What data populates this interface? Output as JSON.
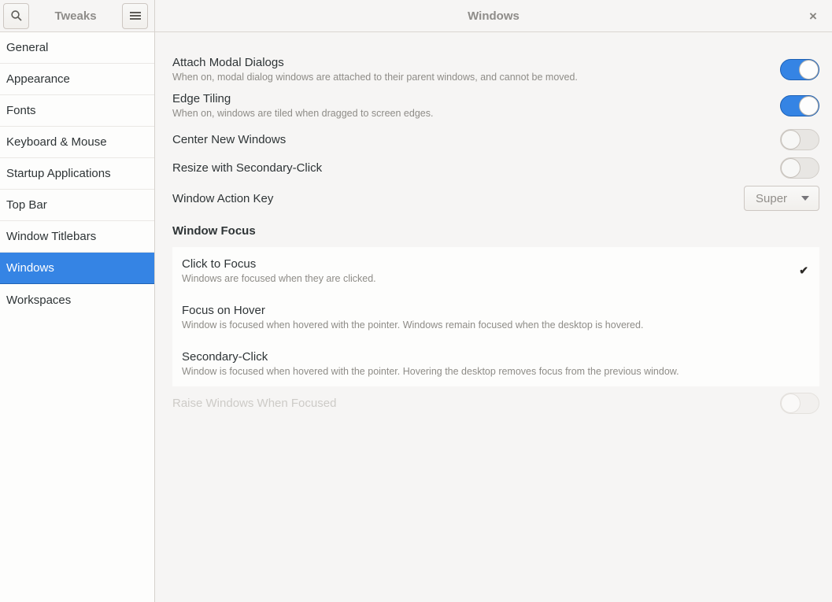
{
  "header": {
    "sidebar_title": "Tweaks",
    "main_title": "Windows"
  },
  "icons": {
    "close": "×",
    "check": "✔"
  },
  "sidebar": {
    "items": [
      {
        "label": "General",
        "selected": false
      },
      {
        "label": "Appearance",
        "selected": false
      },
      {
        "label": "Fonts",
        "selected": false
      },
      {
        "label": "Keyboard & Mouse",
        "selected": false
      },
      {
        "label": "Startup Applications",
        "selected": false
      },
      {
        "label": "Top Bar",
        "selected": false
      },
      {
        "label": "Window Titlebars",
        "selected": false
      },
      {
        "label": "Windows",
        "selected": true
      },
      {
        "label": "Workspaces",
        "selected": false
      }
    ]
  },
  "main": {
    "settings": [
      {
        "title": "Attach Modal Dialogs",
        "description": "When on, modal dialog windows are attached to their parent windows, and cannot be moved.",
        "control": "switch",
        "state": "on"
      },
      {
        "title": "Edge Tiling",
        "description": "When on, windows are tiled when dragged to screen edges.",
        "control": "switch",
        "state": "on"
      },
      {
        "title": "Center New Windows",
        "control": "switch",
        "state": "off"
      },
      {
        "title": "Resize with Secondary-Click",
        "control": "switch",
        "state": "off"
      },
      {
        "title": "Window Action Key",
        "control": "dropdown",
        "value": "Super"
      }
    ],
    "window_focus": {
      "heading": "Window Focus",
      "options": [
        {
          "title": "Click to Focus",
          "description": "Windows are focused when they are clicked.",
          "selected": true
        },
        {
          "title": "Focus on Hover",
          "description": "Window is focused when hovered with the pointer. Windows remain focused when the desktop is hovered.",
          "selected": false
        },
        {
          "title": "Secondary-Click",
          "description": "Window is focused when hovered with the pointer. Hovering the desktop removes focus from the previous window.",
          "selected": false
        }
      ]
    },
    "raise_windows": {
      "title": "Raise Windows When Focused",
      "control": "switch",
      "state": "off",
      "disabled": true
    }
  },
  "colors": {
    "accent": "#3584e4",
    "page_background": "#f6f5f4",
    "card_background": "#fdfdfc",
    "title_text": "#2e3436",
    "secondary_text": "#8e8c87",
    "disabled_text": "#cdcbc7"
  }
}
